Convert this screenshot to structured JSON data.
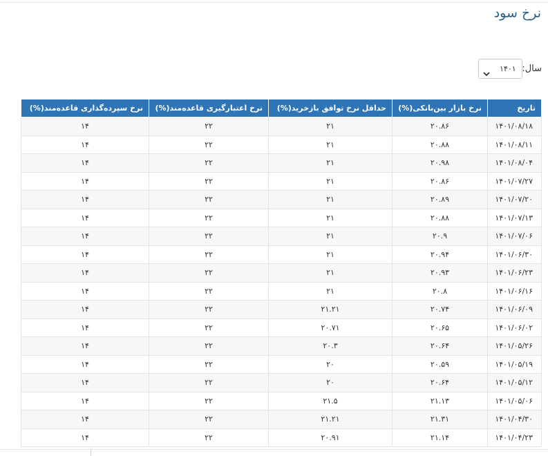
{
  "page": {
    "title": "نرخ سود"
  },
  "filter": {
    "year_label": "سال:",
    "year_value": "۱۴۰۱"
  },
  "table": {
    "headers": [
      "تاریخ",
      "نرخ بازار بین‌بانکی(%)",
      "حداقل نرخ توافق بازخرید(%)",
      "نرخ اعتبارگیری قاعده‌مند(%)",
      "نرخ سپرده‌گذاری قاعده‌مند(%)"
    ],
    "rows": [
      [
        "۱۴۰۱/۰۸/۱۸",
        "۲۰.۸۶",
        "۲۱",
        "۲۲",
        "۱۴"
      ],
      [
        "۱۴۰۱/۰۸/۱۱",
        "۲۰.۸۸",
        "۲۱",
        "۲۲",
        "۱۴"
      ],
      [
        "۱۴۰۱/۰۸/۰۴",
        "۲۰.۹۸",
        "۲۱",
        "۲۲",
        "۱۴"
      ],
      [
        "۱۴۰۱/۰۷/۲۷",
        "۲۰.۸۶",
        "۲۱",
        "۲۲",
        "۱۴"
      ],
      [
        "۱۴۰۱/۰۷/۲۰",
        "۲۰.۸۹",
        "۲۱",
        "۲۲",
        "۱۴"
      ],
      [
        "۱۴۰۱/۰۷/۱۳",
        "۲۰.۸۸",
        "۲۱",
        "۲۲",
        "۱۴"
      ],
      [
        "۱۴۰۱/۰۷/۰۶",
        "۲۰.۹",
        "۲۱",
        "۲۲",
        "۱۴"
      ],
      [
        "۱۴۰۱/۰۶/۳۰",
        "۲۰.۹۴",
        "۲۱",
        "۲۲",
        "۱۴"
      ],
      [
        "۱۴۰۱/۰۶/۲۳",
        "۲۰.۹۳",
        "۲۱",
        "۲۲",
        "۱۴"
      ],
      [
        "۱۴۰۱/۰۶/۱۶",
        "۲۰.۸",
        "۲۱",
        "۲۲",
        "۱۴"
      ],
      [
        "۱۴۰۱/۰۶/۰۹",
        "۲۰.۷۴",
        "۲۱.۲۱",
        "۲۲",
        "۱۴"
      ],
      [
        "۱۴۰۱/۰۶/۰۲",
        "۲۰.۶۵",
        "۲۰.۷۱",
        "۲۲",
        "۱۴"
      ],
      [
        "۱۴۰۱/۰۵/۲۶",
        "۲۰.۶۴",
        "۲۰.۳",
        "۲۲",
        "۱۴"
      ],
      [
        "۱۴۰۱/۰۵/۱۹",
        "۲۰.۵۹",
        "۲۰",
        "۲۲",
        "۱۴"
      ],
      [
        "۱۴۰۱/۰۵/۱۲",
        "۲۰.۶۴",
        "۲۰",
        "۲۲",
        "۱۴"
      ],
      [
        "۱۴۰۱/۰۵/۰۶",
        "۲۱.۱۳",
        "۲۱.۵",
        "۲۲",
        "۱۴"
      ],
      [
        "۱۴۰۱/۰۴/۳۰",
        "۲۱.۳۱",
        "۲۱.۲۱",
        "۲۲",
        "۱۴"
      ],
      [
        "۱۴۰۱/۰۴/۲۳",
        "۲۱.۱۴",
        "۲۰.۹۱",
        "۲۲",
        "۱۴"
      ]
    ]
  }
}
